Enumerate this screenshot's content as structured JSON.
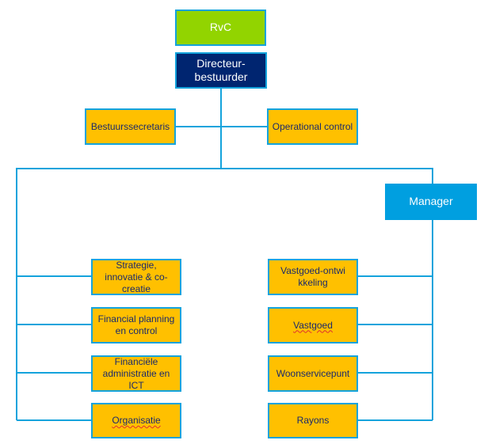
{
  "colors": {
    "line": "#14a3dc",
    "unit": "#ffc000",
    "board": "#92d400",
    "director": "#002570",
    "manager": "#009fe0",
    "unit_text": "#1a2a6c"
  },
  "top": {
    "board": "RvC",
    "director": "Directeur-\nbestuurder"
  },
  "staff": [
    "Bestuurssecretaris",
    "Operational control"
  ],
  "manager": "Manager",
  "left_units": [
    "Strategie, innovatie & co-creatie",
    "Financial planning en control",
    "Financiële administratie en ICT",
    "Organisatie"
  ],
  "right_units": [
    "Vastgoed-ontwikkeling",
    "Vastgoed",
    "Woonservicepunt",
    "Rayons"
  ]
}
